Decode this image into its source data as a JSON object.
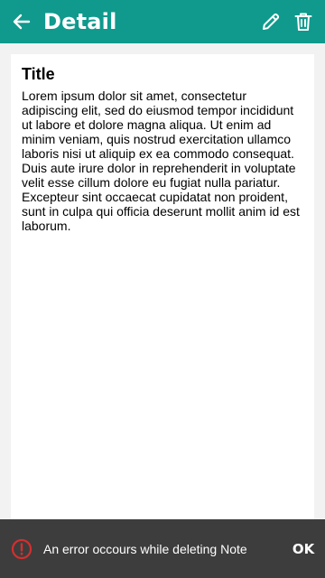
{
  "header": {
    "title": "Detail",
    "back_icon": "arrow-left-icon",
    "edit_icon": "pencil-icon",
    "delete_icon": "trash-icon",
    "background_color": "#0f9a8d"
  },
  "note": {
    "title": "Title",
    "body": "Lorem ipsum dolor sit amet, consectetur adipiscing elit, sed do eiusmod tempor incididunt ut labore et dolore magna aliqua. Ut enim ad minim veniam, quis nostrud exercitation ullamco laboris nisi ut aliquip ex ea commodo consequat. Duis aute irure dolor in reprehenderit in voluptate velit esse cillum dolore eu fugiat nulla pariatur. Excepteur sint occaecat cupidatat non proident, sunt in culpa qui officia deserunt mollit anim id est laborum."
  },
  "snackbar": {
    "icon": "error-circle-icon",
    "icon_color": "#d32f2f",
    "message": "An error occours while deleting Note",
    "action_label": "OK",
    "background_color": "#3d3d3d"
  }
}
